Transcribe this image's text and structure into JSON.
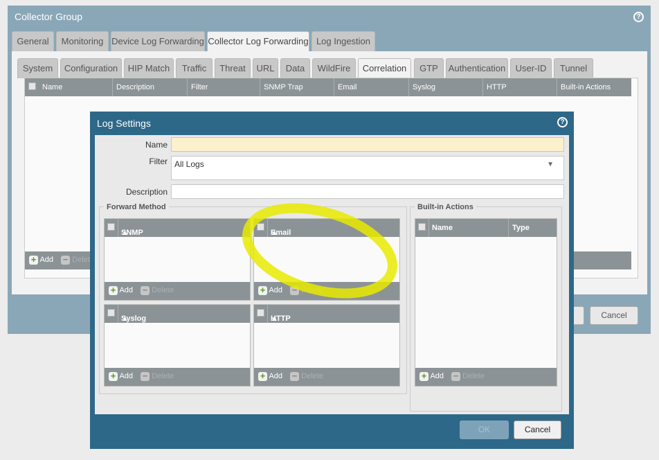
{
  "collector_group": {
    "title": "Collector Group",
    "tabs": [
      "General",
      "Monitoring",
      "Device Log Forwarding",
      "Collector Log Forwarding",
      "Log Ingestion"
    ],
    "subtabs": [
      "System",
      "Configuration",
      "HIP Match",
      "Traffic",
      "Threat",
      "URL",
      "Data",
      "WildFire",
      "Correlation",
      "GTP",
      "Authentication",
      "User-ID",
      "Tunnel"
    ],
    "columns": [
      "Name",
      "Description",
      "Filter",
      "SNMP Trap",
      "Email",
      "Syslog",
      "HTTP",
      "Built-in Actions"
    ],
    "add": "Add",
    "delete": "Delete",
    "ok": "OK",
    "cancel": "Cancel"
  },
  "log_settings": {
    "title": "Log Settings",
    "name_label": "Name",
    "name_value": "",
    "filter_label": "Filter",
    "filter_value": "All Logs",
    "description_label": "Description",
    "description_value": "",
    "forward_method": "Forward Method",
    "grids": [
      "SNMP",
      "Email",
      "Syslog",
      "HTTP"
    ],
    "builtin_actions": "Built-in Actions",
    "builtin_cols": [
      "Name",
      "Type"
    ],
    "add": "Add",
    "delete": "Delete",
    "ok": "OK",
    "cancel": "Cancel"
  },
  "annotation_color": "#e8ea00"
}
